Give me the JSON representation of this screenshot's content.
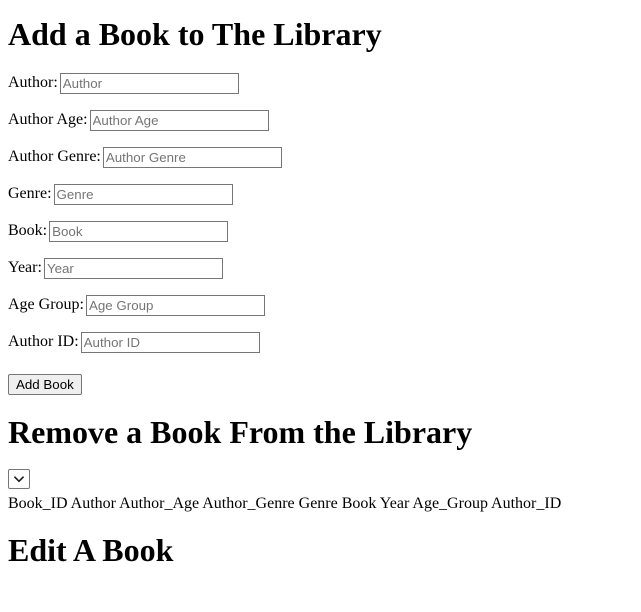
{
  "add_section": {
    "heading": "Add a Book to The Library",
    "fields": [
      {
        "label": "Author:",
        "placeholder": "Author",
        "value": ""
      },
      {
        "label": "Author Age:",
        "placeholder": "Author Age",
        "value": ""
      },
      {
        "label": "Author Genre:",
        "placeholder": "Author Genre",
        "value": ""
      },
      {
        "label": "Genre:",
        "placeholder": "Genre",
        "value": ""
      },
      {
        "label": "Book:",
        "placeholder": "Book",
        "value": ""
      },
      {
        "label": "Year:",
        "placeholder": "Year",
        "value": ""
      },
      {
        "label": "Age Group:",
        "placeholder": "Age Group",
        "value": ""
      },
      {
        "label": "Author ID:",
        "placeholder": "Author ID",
        "value": ""
      }
    ],
    "submit_label": "Add Book"
  },
  "remove_section": {
    "heading": "Remove a Book From the Library",
    "select": {
      "selected_value": "",
      "options": [],
      "icon": "chevron-down-icon"
    },
    "columns_line": "Book_ID Author Author_Age Author_Genre Genre Book Year Age_Group Author_ID",
    "columns": [
      "Book_ID",
      "Author",
      "Author_Age",
      "Author_Genre",
      "Genre",
      "Book",
      "Year",
      "Age_Group",
      "Author_ID"
    ]
  },
  "edit_section": {
    "heading": "Edit A Book"
  },
  "colors": {
    "text": "#000000",
    "placeholder": "#757575",
    "border": "#767676",
    "button_face": "#efefef",
    "background": "#ffffff"
  }
}
